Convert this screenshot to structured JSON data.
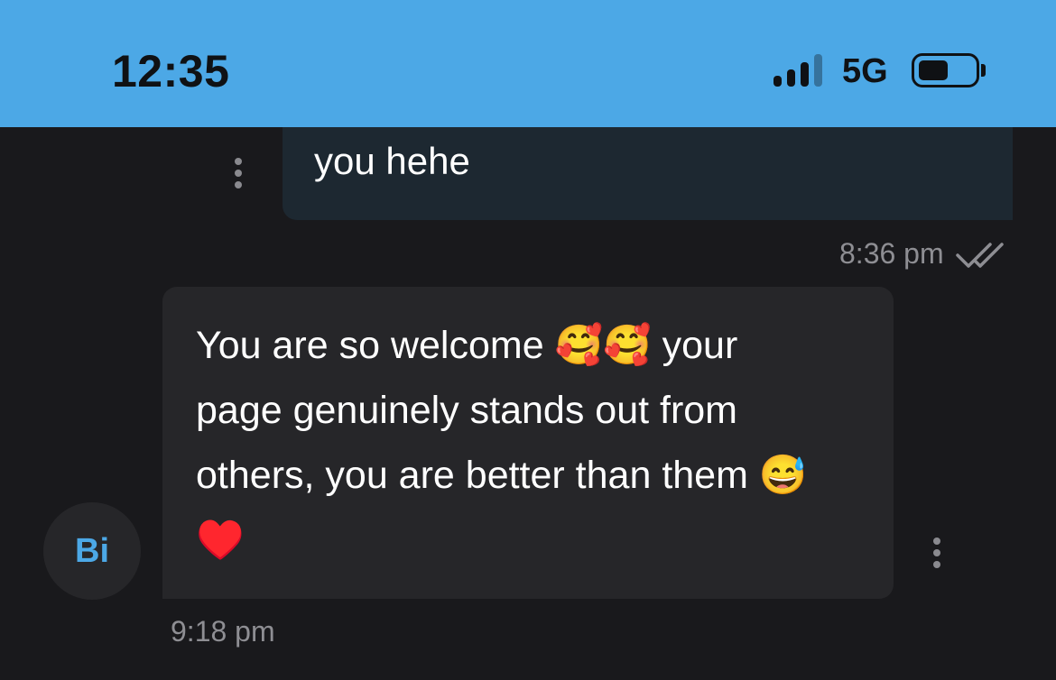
{
  "status_bar": {
    "time": "12:35",
    "network": "5G",
    "signal_bars_filled": 3,
    "signal_bars_total": 4,
    "battery_level": 0.5
  },
  "messages": [
    {
      "direction": "outgoing",
      "text": "you hehe",
      "time": "8:36 pm",
      "status": "read"
    },
    {
      "direction": "incoming",
      "sender_initials": "Bi",
      "text": "You are so welcome 🥰🥰 your page genuinely stands out from others, you are better than them 😅♥️",
      "time": "9:18 pm"
    }
  ],
  "colors": {
    "status_bar": "#4ca8e6",
    "background": "#19191c",
    "outgoing_bubble": "#1d2831",
    "incoming_bubble": "#262629",
    "accent": "#4ca8e6",
    "timestamp": "#8e8e93"
  },
  "icons": {
    "signal": "cellular-signal-icon",
    "battery": "battery-icon",
    "read_receipt": "double-check-icon",
    "options": "more-vertical-icon"
  }
}
